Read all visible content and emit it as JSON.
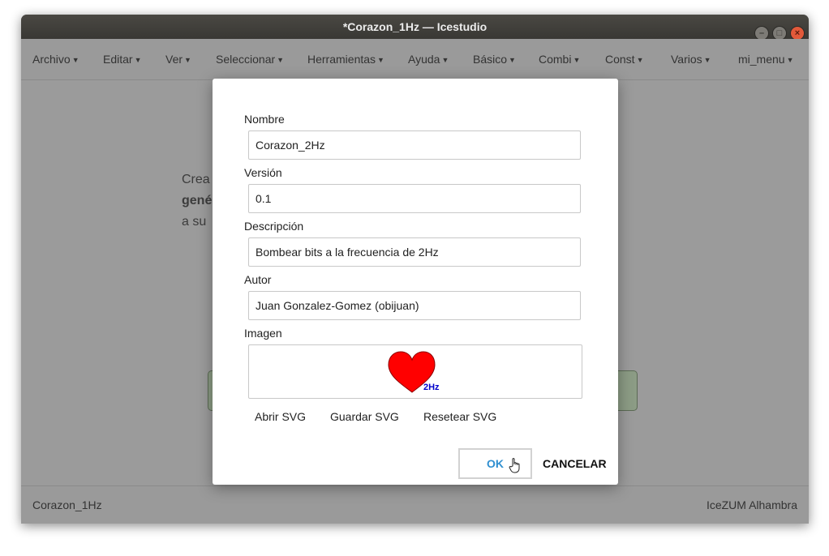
{
  "window": {
    "title": "*Corazon_1Hz — Icestudio"
  },
  "menu": [
    {
      "id": "archivo",
      "label": "Archivo"
    },
    {
      "id": "editar",
      "label": "Editar"
    },
    {
      "id": "ver",
      "label": "Ver"
    },
    {
      "id": "seleccionar",
      "label": "Seleccionar"
    },
    {
      "id": "herramientas",
      "label": "Herramientas"
    },
    {
      "id": "ayuda",
      "label": "Ayuda"
    },
    {
      "id": "basico",
      "label": "Básico"
    },
    {
      "id": "combi",
      "label": "Combi"
    },
    {
      "id": "const",
      "label": "Const"
    },
    {
      "id": "varios",
      "label": "Varios"
    },
    {
      "id": "mi-menu",
      "label": "mi_menu"
    }
  ],
  "background": {
    "line1": "Crea",
    "line2": "gené",
    "line3": "a su"
  },
  "footer": {
    "left": "Corazon_1Hz",
    "right": "IceZUM Alhambra"
  },
  "dialog": {
    "name_label": "Nombre",
    "name_value": "Corazon_2Hz",
    "version_label": "Versión",
    "version_value": "0.1",
    "description_label": "Descripción",
    "description_value": "Bombear bits a la frecuencia de 2Hz",
    "author_label": "Autor",
    "author_value": "Juan Gonzalez-Gomez (obijuan)",
    "image_label": "Imagen",
    "image_caption": "2Hz",
    "open_svg": "Abrir SVG",
    "save_svg": "Guardar SVG",
    "reset_svg": "Resetear SVG",
    "ok": "OK",
    "cancel": "CANCELAR"
  },
  "colors": {
    "heart": "#ff0000",
    "caption": "#0000cc",
    "ok_text": "#2f8fd0",
    "overlay_bg": "#9b9b9b",
    "titlebar": "#3c3b37",
    "close_button": "#e2593a"
  },
  "icons": {
    "cursor": "hand-pointer-icon",
    "caret": "caret-down-icon"
  }
}
